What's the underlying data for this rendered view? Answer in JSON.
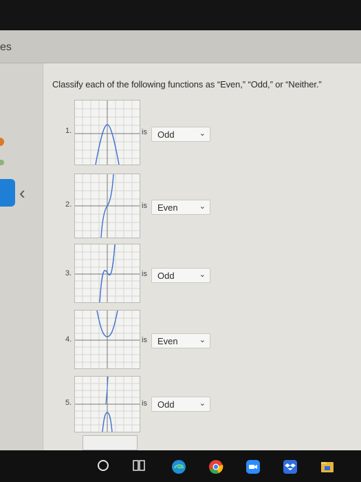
{
  "header": {
    "partial_text": "es"
  },
  "question": {
    "prompt": "Classify each of the following functions as “Even,” “Odd,” or “Neither.”"
  },
  "is_label": "is",
  "items": [
    {
      "num": "1.",
      "answer": "Odd"
    },
    {
      "num": "2.",
      "answer": "Even"
    },
    {
      "num": "3.",
      "answer": "Odd"
    },
    {
      "num": "4.",
      "answer": "Even"
    },
    {
      "num": "5.",
      "answer": "Odd"
    }
  ],
  "colors": {
    "curve": "#3b6fd1",
    "accent": "#1f7fd6",
    "taskbar": "#111111"
  },
  "taskbar_icons": [
    "search-circle-icon",
    "task-view-icon",
    "edge-icon",
    "chrome-icon",
    "zoom-icon",
    "dropbox-icon",
    "file-explorer-icon"
  ]
}
